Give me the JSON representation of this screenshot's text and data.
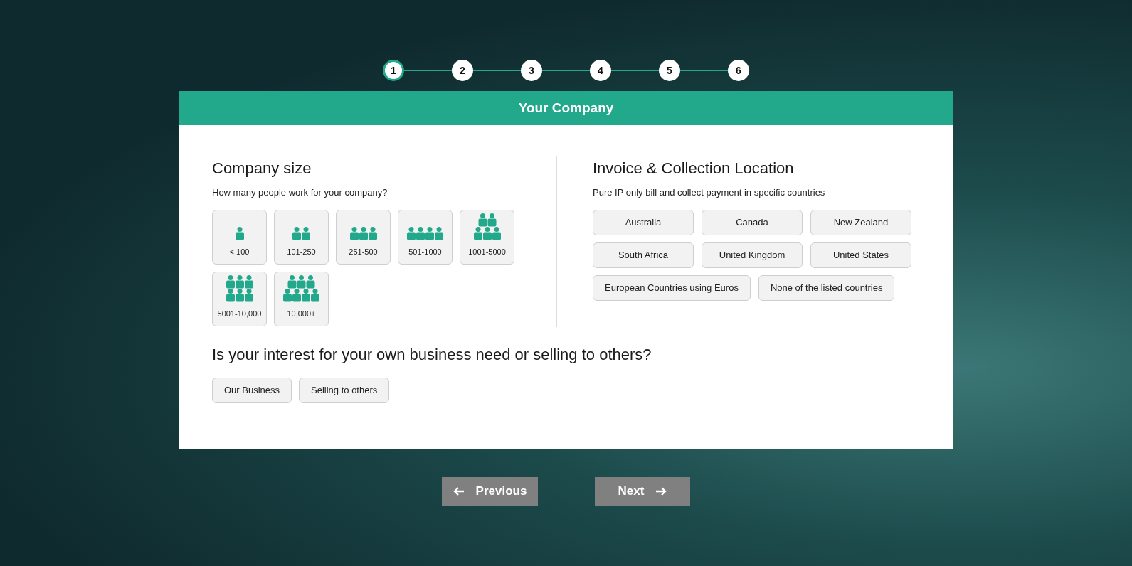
{
  "steps": [
    {
      "label": "1",
      "selected": true
    },
    {
      "label": "2",
      "selected": false
    },
    {
      "label": "3",
      "selected": false
    },
    {
      "label": "4",
      "selected": false
    },
    {
      "label": "5",
      "selected": false
    },
    {
      "label": "6",
      "selected": false
    }
  ],
  "card": {
    "title": "Your Company",
    "company_size": {
      "heading": "Company size",
      "subheading": "How many people work for your company?",
      "options": [
        {
          "label": "< 100",
          "kind": "one"
        },
        {
          "label": "101-250",
          "kind": "two"
        },
        {
          "label": "251-500",
          "kind": "three"
        },
        {
          "label": "501-1000",
          "kind": "four"
        },
        {
          "label": "1001-5000",
          "kind": "pyramid"
        },
        {
          "label": "5001-10,000",
          "kind": "grid"
        },
        {
          "label": "10,000+",
          "kind": "large"
        }
      ]
    },
    "location": {
      "heading": "Invoice & Collection Location",
      "subheading": "Pure IP only bill and collect payment in specific countries",
      "options": [
        "Australia",
        "Canada",
        "New Zealand",
        "South Africa",
        "United Kingdom",
        "United States",
        "European Countries using Euros",
        "None of the listed countries"
      ]
    },
    "interest": {
      "heading": "Is your interest for your own business need or selling to others?",
      "options": [
        "Our Business",
        "Selling to others"
      ]
    }
  },
  "nav": {
    "previous": "Previous",
    "next": "Next"
  }
}
